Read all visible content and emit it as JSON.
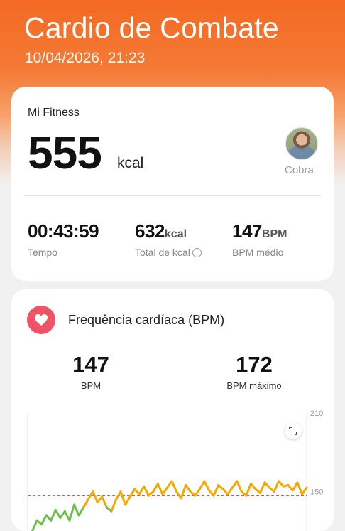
{
  "header": {
    "title": "Cardio de Combate",
    "datetime": "10/04/2026, 21:23"
  },
  "summary": {
    "source": "Mi Fitness",
    "calories_value": "555",
    "calories_unit": "kcal",
    "user_name": "Cobra",
    "stats": [
      {
        "value": "00:43:59",
        "unit": "",
        "label": "Tempo"
      },
      {
        "value": "632",
        "unit": "kcal",
        "label": "Total de kcal"
      },
      {
        "value": "147",
        "unit": "BPM",
        "label": "BPM médio"
      }
    ]
  },
  "heart_rate": {
    "title": "Frequência cardíaca (BPM)",
    "avg_value": "147",
    "avg_label": "BPM",
    "max_value": "172",
    "max_label": "BPM máximo"
  },
  "colors": {
    "accent": "#f36a23",
    "heart": "#ee5366",
    "line_orange": "#f5a800",
    "line_green": "#6cc04a",
    "line_blue": "#3d8df5",
    "avg_dash": "#e8384f"
  },
  "chart_data": {
    "type": "line",
    "y_ticks": [
      "210",
      "150"
    ],
    "ylim": [
      120,
      210
    ],
    "avg_line": 147,
    "x": [
      0,
      1,
      2,
      3,
      4,
      5,
      6,
      7,
      8,
      9,
      10,
      11,
      12,
      13,
      14,
      15,
      16,
      17,
      18,
      19,
      20,
      21,
      22,
      23,
      24,
      25,
      26,
      27,
      28,
      29,
      30,
      31,
      32,
      33,
      34,
      35,
      36,
      37,
      38,
      39,
      40,
      41,
      42,
      43,
      44,
      45,
      46,
      47,
      48,
      49,
      50,
      51,
      52,
      53,
      54,
      55,
      56,
      57,
      58,
      59,
      60
    ],
    "series": [
      {
        "values": [
          110,
          120,
          128,
          125,
          132,
          128,
          136,
          130,
          135,
          128,
          140,
          132,
          138,
          144,
          150,
          142,
          146,
          138,
          135,
          144,
          150,
          140,
          146,
          152,
          148,
          154,
          147,
          150,
          156,
          148,
          153,
          158,
          150,
          145,
          155,
          150,
          147,
          152,
          158,
          151,
          147,
          155,
          152,
          148,
          153,
          158,
          150,
          147,
          156,
          152,
          149,
          157,
          153,
          150,
          158,
          154,
          155,
          151,
          157,
          148,
          153
        ]
      }
    ]
  }
}
